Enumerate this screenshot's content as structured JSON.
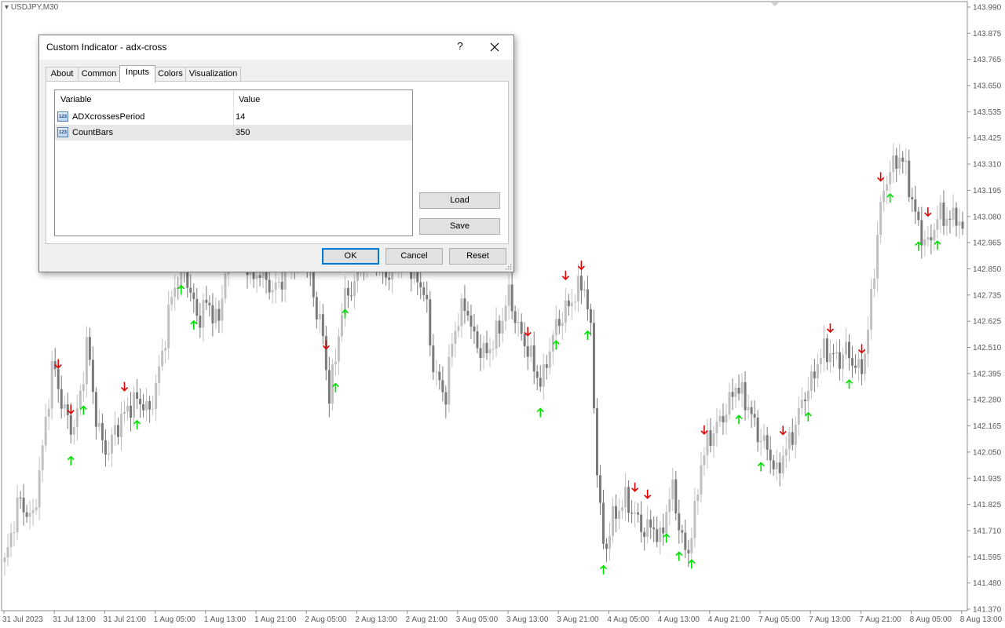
{
  "chart": {
    "symbol": "USDJPY,M30",
    "price_labels": [
      "143.990",
      "143.875",
      "143.765",
      "143.650",
      "143.535",
      "143.425",
      "143.310",
      "143.195",
      "143.080",
      "142.965",
      "142.850",
      "142.735",
      "142.625",
      "142.510",
      "142.395",
      "142.280",
      "142.165",
      "142.050",
      "141.935",
      "141.825",
      "141.710",
      "141.595",
      "141.480",
      "141.370"
    ],
    "time_labels": [
      "31 Jul 2023",
      "31 Jul 13:00",
      "31 Jul 21:00",
      "1 Aug 05:00",
      "1 Aug 13:00",
      "1 Aug 21:00",
      "2 Aug 05:00",
      "2 Aug 13:00",
      "2 Aug 21:00",
      "3 Aug 05:00",
      "3 Aug 13:00",
      "3 Aug 21:00",
      "4 Aug 05:00",
      "4 Aug 13:00",
      "4 Aug 21:00",
      "7 Aug 05:00",
      "7 Aug 13:00",
      "7 Aug 21:00",
      "8 Aug 05:00",
      "8 Aug 13:00"
    ],
    "colors": {
      "bull": "#c0c0c0",
      "bear": "#7a7a7a",
      "up_arrow": "#00e000",
      "down_arrow": "#e00000"
    },
    "price_axis": {
      "max": 143.99,
      "min": 141.37
    },
    "closes": [
      141.57,
      141.7,
      141.85,
      141.8,
      141.75,
      141.95,
      142.2,
      142.45,
      142.3,
      142.2,
      142.15,
      142.3,
      142.55,
      142.25,
      142.1,
      142.05,
      142.15,
      142.2,
      142.25,
      142.28,
      142.27,
      142.22,
      142.35,
      142.5,
      142.7,
      142.8,
      142.85,
      142.75,
      142.62,
      142.7,
      142.68,
      142.6,
      142.85,
      143.0,
      142.95,
      142.9,
      142.8,
      142.85,
      142.8,
      142.75,
      142.8,
      142.85,
      142.9,
      142.95,
      142.85,
      142.7,
      142.6,
      142.3,
      142.45,
      142.7,
      142.75,
      142.8,
      142.9,
      142.95,
      142.9,
      142.85,
      142.8,
      142.9,
      142.95,
      142.85,
      142.8,
      142.75,
      142.45,
      142.35,
      142.3,
      142.55,
      142.65,
      142.7,
      142.55,
      142.5,
      142.48,
      142.55,
      142.6,
      142.75,
      142.65,
      142.55,
      142.5,
      142.4,
      142.35,
      142.5,
      142.6,
      142.65,
      142.7,
      142.75,
      142.8,
      142.6,
      141.95,
      141.6,
      141.75,
      141.8,
      141.85,
      141.8,
      141.75,
      141.7,
      141.75,
      141.65,
      141.8,
      141.9,
      141.7,
      141.6,
      141.75,
      142.0,
      142.1,
      142.15,
      142.2,
      142.25,
      142.35,
      142.3,
      142.25,
      142.15,
      142.1,
      142.05,
      141.95,
      142.05,
      142.1,
      142.2,
      142.3,
      142.35,
      142.45,
      142.5,
      142.48,
      142.45,
      142.5,
      142.45,
      142.4,
      142.5,
      142.8,
      143.1,
      143.25,
      143.3,
      143.35,
      143.25,
      143.1,
      143.0,
      142.95,
      143.05,
      143.1,
      143.05,
      143.1,
      143.0
    ],
    "signals": [
      {
        "bar": 17,
        "dir": "down"
      },
      {
        "bar": 21,
        "dir": "down"
      },
      {
        "bar": 21,
        "dir": "up"
      },
      {
        "bar": 25,
        "dir": "up"
      },
      {
        "bar": 38,
        "dir": "down"
      },
      {
        "bar": 42,
        "dir": "up"
      },
      {
        "bar": 54,
        "dir": "down"
      },
      {
        "bar": 56,
        "dir": "down"
      },
      {
        "bar": 56,
        "dir": "up"
      },
      {
        "bar": 60,
        "dir": "up"
      },
      {
        "bar": 102,
        "dir": "down"
      },
      {
        "bar": 105,
        "dir": "up"
      },
      {
        "bar": 108,
        "dir": "up"
      },
      {
        "bar": 111,
        "dir": "down"
      },
      {
        "bar": 114,
        "dir": "down"
      },
      {
        "bar": 166,
        "dir": "down"
      },
      {
        "bar": 170,
        "dir": "up"
      },
      {
        "bar": 175,
        "dir": "up"
      },
      {
        "bar": 178,
        "dir": "down"
      },
      {
        "bar": 183,
        "dir": "down"
      },
      {
        "bar": 185,
        "dir": "up"
      },
      {
        "bar": 190,
        "dir": "up"
      },
      {
        "bar": 200,
        "dir": "down"
      },
      {
        "bar": 204,
        "dir": "down"
      },
      {
        "bar": 210,
        "dir": "up"
      },
      {
        "bar": 214,
        "dir": "up"
      },
      {
        "bar": 218,
        "dir": "up"
      },
      {
        "bar": 222,
        "dir": "down"
      },
      {
        "bar": 233,
        "dir": "up"
      },
      {
        "bar": 240,
        "dir": "up"
      },
      {
        "bar": 247,
        "dir": "down"
      },
      {
        "bar": 255,
        "dir": "up"
      },
      {
        "bar": 262,
        "dir": "down"
      },
      {
        "bar": 268,
        "dir": "up"
      },
      {
        "bar": 272,
        "dir": "down"
      },
      {
        "bar": 278,
        "dir": "down"
      },
      {
        "bar": 281,
        "dir": "up"
      },
      {
        "bar": 290,
        "dir": "up"
      },
      {
        "bar": 293,
        "dir": "down"
      },
      {
        "bar": 296,
        "dir": "up"
      }
    ]
  },
  "dialog": {
    "title": "Custom Indicator - adx-cross",
    "help": "?",
    "tabs": [
      "About",
      "Common",
      "Inputs",
      "Colors",
      "Visualization"
    ],
    "active_tab": "Inputs",
    "table": {
      "headers": [
        "Variable",
        "Value"
      ],
      "rows": [
        {
          "variable": "ADXcrossesPeriod",
          "value": "14",
          "icon": "123"
        },
        {
          "variable": "CountBars",
          "value": "350",
          "icon": "123"
        }
      ]
    },
    "buttons": {
      "load": "Load",
      "save": "Save",
      "ok": "OK",
      "cancel": "Cancel",
      "reset": "Reset"
    }
  }
}
